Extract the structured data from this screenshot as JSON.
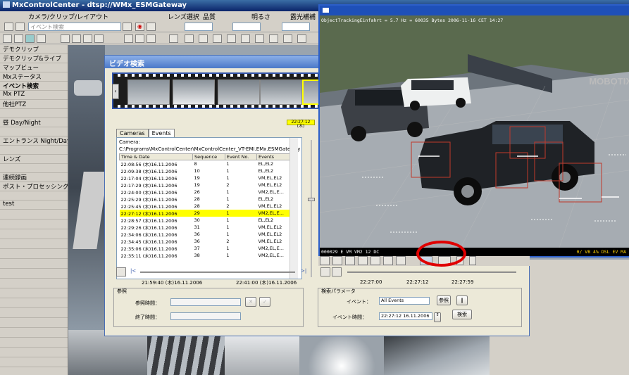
{
  "app": {
    "title": "MxControlCenter - dtsp://WMx_ESMGateway",
    "menu": [
      "カメラ/クリップ/レイアウト",
      "レンズ選択",
      "品質",
      "明るさ",
      "露光補補"
    ],
    "toolbar_combo": "イベント検索"
  },
  "sidebar": {
    "items": [
      "デモクリップ",
      "デモクリップ&ライブ",
      "マップビュー",
      "Mxステータス",
      "イベント検索",
      "Mx PTZ",
      "他社PTZ",
      "",
      "昼 Day/Night",
      "",
      "エントランス Night/Day",
      "",
      "レンズ",
      "",
      "連続録画",
      "ポスト・プロセッシング検出",
      "",
      "test"
    ]
  },
  "dialog": {
    "title": "ビデオ検索",
    "tabs": [
      "Cameras",
      "Events"
    ],
    "active_tab": "Events",
    "time_strip": "22:27:12 (木)",
    "camera_label": "Camera:",
    "camera_path": "C:\\Programs\\MxControlCenter\\MxControlCenter_VT-EMI.EMx.ESMGateway",
    "table": {
      "headers": [
        "Time & Date",
        "Sequence",
        "Event No.",
        "Events"
      ],
      "rows": [
        [
          "22:08:56 (木)16.11.2006",
          "8",
          "1",
          "EL,EL2"
        ],
        [
          "22:09:38 (木)16.11.2006",
          "10",
          "1",
          "EL,EL2"
        ],
        [
          "22:17:04 (木)16.11.2006",
          "19",
          "1",
          "VM,EL,EL2"
        ],
        [
          "22:17:29 (木)16.11.2006",
          "19",
          "2",
          "VM,EL,EL2"
        ],
        [
          "22:24:00 (木)16.11.2006",
          "26",
          "1",
          "VM2,EL,E..."
        ],
        [
          "22:25:29 (木)16.11.2006",
          "28",
          "1",
          "EL,EL2"
        ],
        [
          "22:25:45 (木)16.11.2006",
          "28",
          "2",
          "VM,EL,EL2"
        ],
        [
          "22:27:12 (木)16.11.2006",
          "29",
          "1",
          "VM2,EL,E..."
        ],
        [
          "22:28:57 (木)16.11.2006",
          "30",
          "1",
          "EL,EL2"
        ],
        [
          "22:29:26 (木)16.11.2006",
          "31",
          "1",
          "VM,EL,EL2"
        ],
        [
          "22:34:06 (木)16.11.2006",
          "36",
          "1",
          "VM,EL,EL2"
        ],
        [
          "22:34:45 (木)16.11.2006",
          "36",
          "2",
          "VM,EL,EL2"
        ],
        [
          "22:35:06 (木)16.11.2006",
          "37",
          "1",
          "VM2,EL,E..."
        ],
        [
          "22:35:11 (木)16.11.2006",
          "38",
          "1",
          "VM2,EL,E..."
        ]
      ],
      "selected_index": 7
    },
    "range_start": "21:59:40 (木)16.11.2006",
    "range_end": "22:41:00 (木)16.11.2006",
    "ref_group": {
      "legend": "参照",
      "ref_time_label": "参照時間：",
      "end_time_label": "終了時間："
    },
    "play_times": [
      "22:27:00",
      "22:27:12",
      "22:27:59"
    ],
    "search_group": {
      "legend": "検索パラメータ",
      "event_label": "イベント：",
      "event_value": "All Events",
      "ref_button": "参照",
      "event_time_label": "イベント時間：",
      "event_time_value": "22:27:12 16.11.2006",
      "search_button": "検索"
    }
  },
  "video": {
    "overlay": "ObjectTrackingEinfahrt  =  5.7 Hz  =  60035 Bytes     2006-11-16 CET 14:27",
    "status_left": "000029 E  VM  VM2  12  DC",
    "status_right": "0/  VB 4% DSL EV  MA",
    "watermark": "MOBOTIX"
  },
  "colors": {
    "accent": "#0a246a",
    "selection": "#ffff00",
    "highlight_circle": "#e00000"
  }
}
